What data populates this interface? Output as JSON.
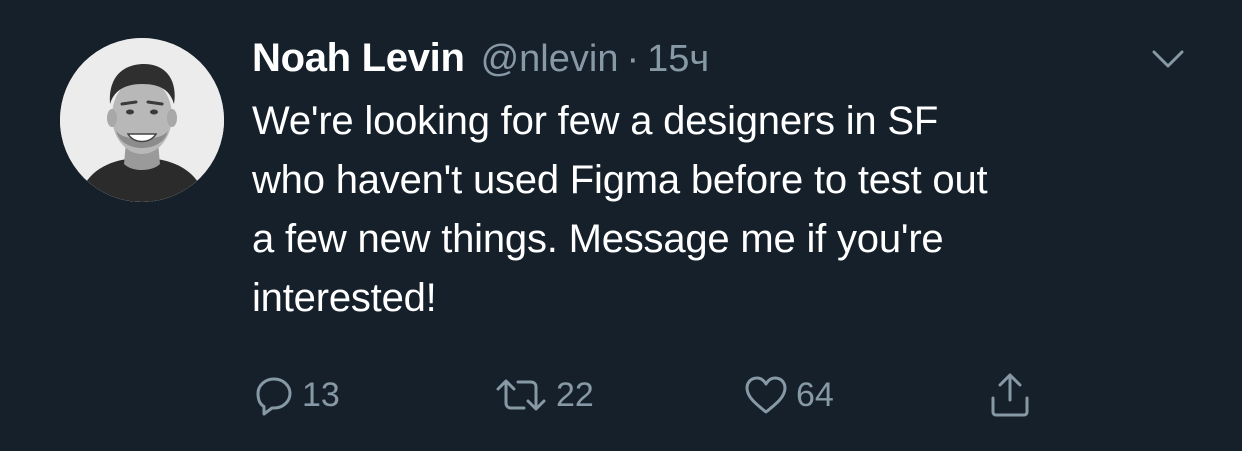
{
  "theme": {
    "background": "#15202b",
    "text_primary": "#ffffff",
    "text_secondary": "#8899a6"
  },
  "tweet": {
    "author": {
      "name": "Noah Levin",
      "handle": "@nlevin",
      "avatar_icon": "profile-photo"
    },
    "separator": "·",
    "time": "15ч",
    "text": "We're looking for few a designers in SF\nwho haven't used Figma before to test out\na few new things. Message me if you're\ninterested!",
    "menu_icon": "chevron-down-icon",
    "actions": {
      "reply": {
        "icon": "reply-icon",
        "count": "13"
      },
      "retweet": {
        "icon": "retweet-icon",
        "count": "22"
      },
      "like": {
        "icon": "heart-icon",
        "count": "64"
      },
      "share": {
        "icon": "share-icon"
      }
    }
  }
}
